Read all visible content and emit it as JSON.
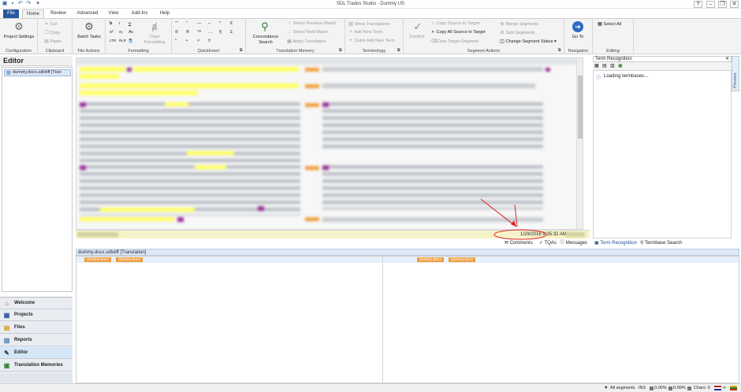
{
  "window": {
    "title": "SDL Trados Studio - Dummy US"
  },
  "tabs": [
    "File",
    "Home",
    "Review",
    "Advanced",
    "View",
    "Add-Ins",
    "Help"
  ],
  "ribbon": {
    "configuration": {
      "label": "Configuration",
      "project_settings": "Project Settings"
    },
    "clipboard": {
      "label": "Clipboard",
      "cut": "Cut",
      "copy": "Copy",
      "paste": "Paste"
    },
    "file_actions": {
      "label": "File Actions",
      "batch_tasks": "Batch Tasks"
    },
    "formatting": {
      "label": "Formatting",
      "clear_formatting": "Clear Formatting"
    },
    "quickinsert": {
      "label": "QuickInsert"
    },
    "translation_memory": {
      "label": "Translation Memory",
      "concordance_search": "Concordance Search",
      "select_previous_match": "Select Previous Match",
      "select_next_match": "Select Next Match",
      "apply_translation": "Apply Translation"
    },
    "terminology": {
      "label": "Terminology",
      "show_translations": "Show Translations",
      "add_new_term": "Add New Term",
      "quick_add_new_term": "Quick Add New Term"
    },
    "segment_actions": {
      "label": "Segment Actions",
      "confirm": "Confirm",
      "copy_source": "Copy Source to Target",
      "copy_all_source": "Copy All Source to Target",
      "clear_target": "Clear Target Segment",
      "merge_segments": "Merge Segments",
      "split_segments": "Split Segments",
      "change_status": "Change Segment Status"
    },
    "navigation": {
      "label": "Navigation",
      "go_to": "Go To"
    },
    "editing": {
      "label": "Editing",
      "select_all": "Select All"
    }
  },
  "editor": {
    "heading": "Editor",
    "file_item": "dummy.docx.sdlxliff [Tran",
    "timestamp": "1/29/2016 9:35:32 AM",
    "bottom_tabs": [
      "Comments",
      "TQAs",
      "Messages",
      "Term Recognition",
      "Termbase Search"
    ]
  },
  "navigation": [
    "Welcome",
    "Projects",
    "Files",
    "Reports",
    "Editor",
    "Translation Memories"
  ],
  "preview": {
    "header": "dummy.docx.sdlxliff [Translation]",
    "tag": "dummy.docx"
  },
  "term_recognition": {
    "title": "Term Recognition",
    "loading": "Loading termbases...",
    "side_tab": "Preview"
  },
  "statusbar": {
    "segments": "All segments",
    "mode": "INS",
    "pct1": "0.00%",
    "pct2": "0.00%",
    "chars": "Chars: 0"
  }
}
